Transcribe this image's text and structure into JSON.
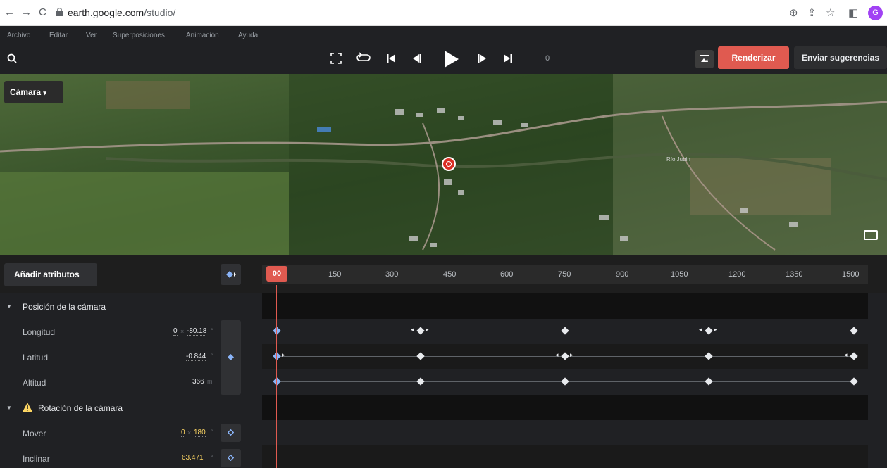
{
  "browser": {
    "url_domain": "earth.google.com",
    "url_path": "/studio/",
    "avatar_letter": "G"
  },
  "menu": [
    "Archivo",
    "Editar",
    "Ver",
    "Superposiciones",
    "Animación",
    "Ayuda"
  ],
  "toolbar": {
    "frame_number": "0",
    "render_label": "Renderizar",
    "feedback_label": "Enviar sugerencias"
  },
  "map": {
    "camera_dropdown": "Cámara",
    "river_label": "Río Jubin"
  },
  "timeline": {
    "add_attributes": "Añadir atributos",
    "playhead": "00",
    "ticks": [
      "150",
      "300",
      "450",
      "600",
      "750",
      "900",
      "1050",
      "1200",
      "1350",
      "1500"
    ]
  },
  "properties": {
    "camera_position": {
      "title": "Posición de la cámara",
      "longitude": {
        "label": "Longitud",
        "prefix": "0",
        "value": "-80.18",
        "unit": "°"
      },
      "latitude": {
        "label": "Latitud",
        "value": "-0.844",
        "unit": "°"
      },
      "altitude": {
        "label": "Altitud",
        "value": "366",
        "unit": "m"
      }
    },
    "camera_rotation": {
      "title": "Rotación de la cámara",
      "pan": {
        "label": "Mover",
        "prefix": "0",
        "value": "180",
        "unit": "°"
      },
      "tilt": {
        "label": "Inclinar",
        "value": "63.471",
        "unit": "°"
      }
    }
  },
  "colors": {
    "accent_red": "#e05a50",
    "keyframe_blue": "#8ab4f8",
    "warning_yellow": "#fdd663"
  }
}
